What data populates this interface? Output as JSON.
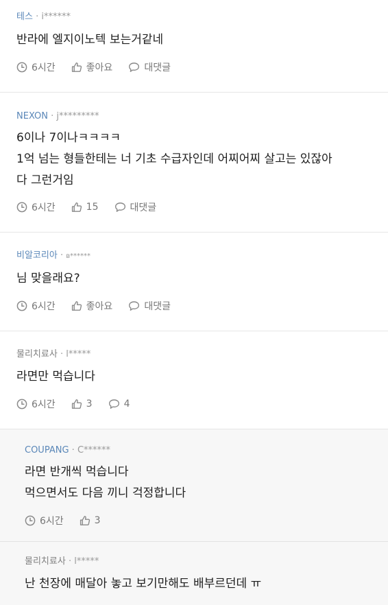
{
  "comments": [
    {
      "nickname": "테스",
      "user_id": "i******",
      "lines": [
        "반라에 엘지이노텍 보는거같네"
      ],
      "time": "6시간",
      "like_label": "좋아요",
      "reply_label": "대댓글"
    },
    {
      "nickname": "NEXON",
      "user_id": "j*********",
      "lines": [
        "6이나 7이나ㅋㅋㅋㅋ",
        "1억 넘는 형들한테는 너 기초 수급자인데 어찌어찌 살고는 있잖아",
        "다 그런거임"
      ],
      "time": "6시간",
      "like_label": "15",
      "reply_label": "대댓글"
    },
    {
      "nickname": "비알코리아",
      "user_id": "ʙ******",
      "lines": [
        "님 맞을래요?"
      ],
      "time": "6시간",
      "like_label": "좋아요",
      "reply_label": "대댓글"
    },
    {
      "nickname": "물리치료사",
      "user_id": "l*****",
      "lines": [
        "라면만 먹습니다"
      ],
      "time": "6시간",
      "like_label": "3",
      "reply_label": "4"
    },
    {
      "nickname": "COUPANG",
      "user_id": "C******",
      "lines": [
        "라면 반개씩 먹습니다",
        "먹으면서도 다음 끼니 걱정합니다"
      ],
      "time": "6시간",
      "like_label": "3"
    },
    {
      "nickname": "물리치료사",
      "user_id": "l*****",
      "lines": [
        "난 천장에 매달아 놓고 보기만해도 배부르던데 ㅠ"
      ]
    }
  ],
  "separator": "·",
  "icons": {
    "time": "clock-icon",
    "like": "thumbs-up-icon",
    "reply": "speech-bubble-icon"
  },
  "colors": {
    "nickname_blue": "#5a87b8",
    "nickname_gray": "#808080",
    "body_text": "#1e1e1e",
    "action_text": "#777777",
    "reply_background": "#f7f7f7"
  }
}
